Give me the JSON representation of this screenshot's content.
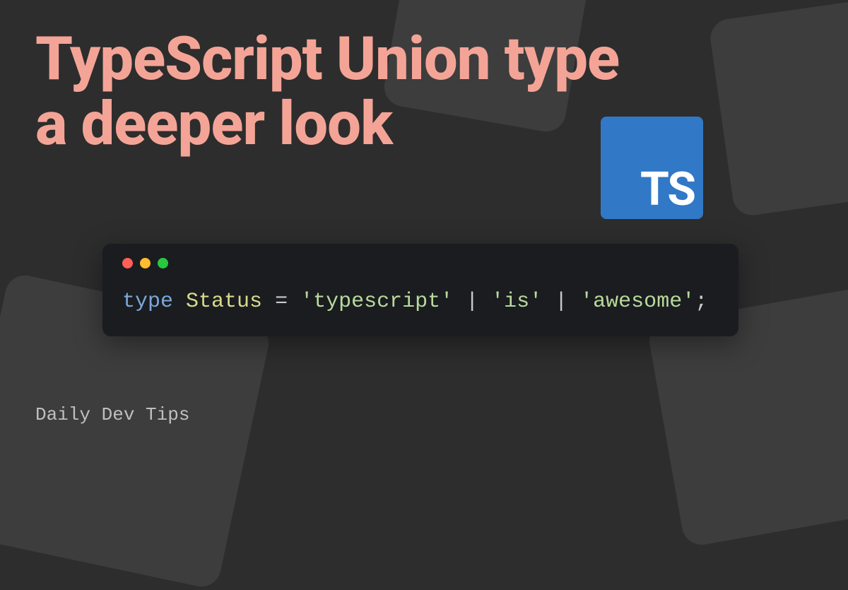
{
  "title": {
    "line1": "TypeScript Union type",
    "line2": "a deeper look"
  },
  "ts_logo": {
    "text": "TS"
  },
  "code": {
    "keyword": "type",
    "type_name": "Status",
    "equals": " = ",
    "string1": "'typescript'",
    "pipe": " | ",
    "string2": "'is'",
    "string3": "'awesome'",
    "semicolon": ";"
  },
  "footer": {
    "text": "Daily Dev Tips"
  },
  "colors": {
    "background": "#2d2d2d",
    "title": "#f4a496",
    "ts_logo_bg": "#3178c6",
    "code_bg": "#1a1c20"
  }
}
